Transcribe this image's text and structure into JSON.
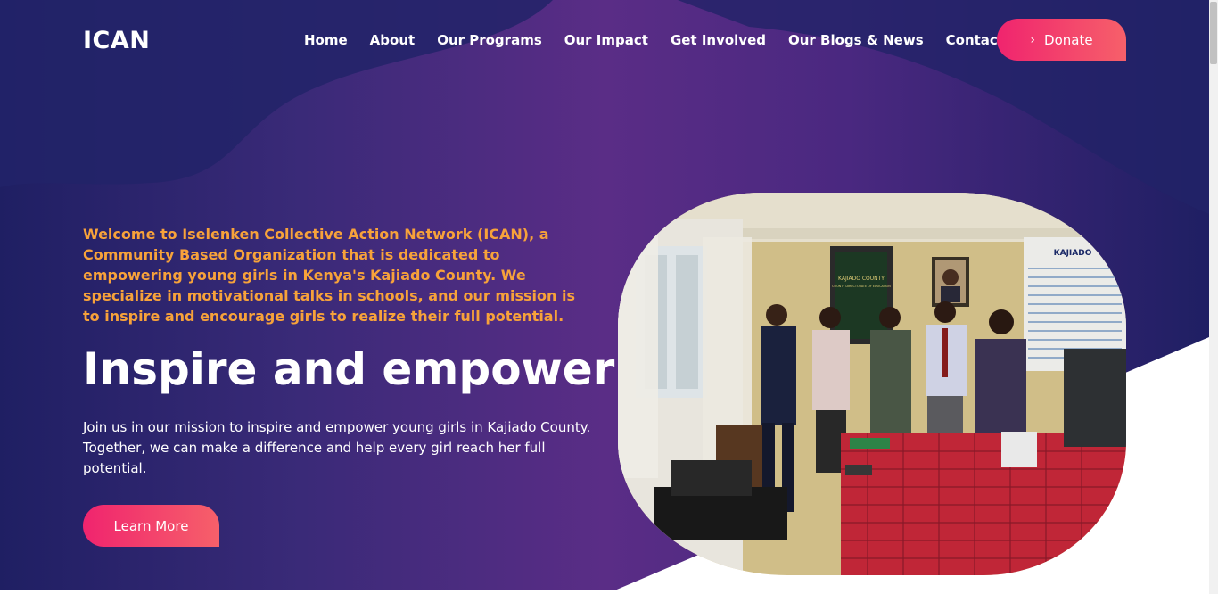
{
  "brand": {
    "name": "ICAN"
  },
  "nav": {
    "items": [
      {
        "label": "Home"
      },
      {
        "label": "About"
      },
      {
        "label": "Our Programs"
      },
      {
        "label": "Our Impact"
      },
      {
        "label": "Get Involved"
      },
      {
        "label": "Our Blogs & News"
      },
      {
        "label": "Contact Us"
      }
    ],
    "donate_label": "Donate",
    "donate_icon": "chevron-right-icon"
  },
  "hero": {
    "intro": "Welcome to Iselenken Collective Action Network (ICAN), a Community Based Organization that is dedicated to empowering young girls in Kenya's Kajiado County. We specialize in motivational talks in schools, and our mission is to inspire and encourage girls to realize their full potential.",
    "headline": "Inspire and empower",
    "subtext": "Join us in our mission to inspire and empower young girls in Kajiado County. Together, we can make a difference and help every girl reach her full potential.",
    "cta_label": "Learn More"
  },
  "photo": {
    "poster_heading": "KAJIADO COUNTY",
    "poster_subheading": "COUNTY DIRECTORATE OF EDUCATION",
    "board_title": "KAJIADO"
  },
  "colors": {
    "accent_orange": "#f7a23a",
    "button_pink": "#f0246e",
    "button_coral": "#f6606a",
    "bg_navy": "#1f1f63",
    "bg_purple": "#5a2d86"
  }
}
